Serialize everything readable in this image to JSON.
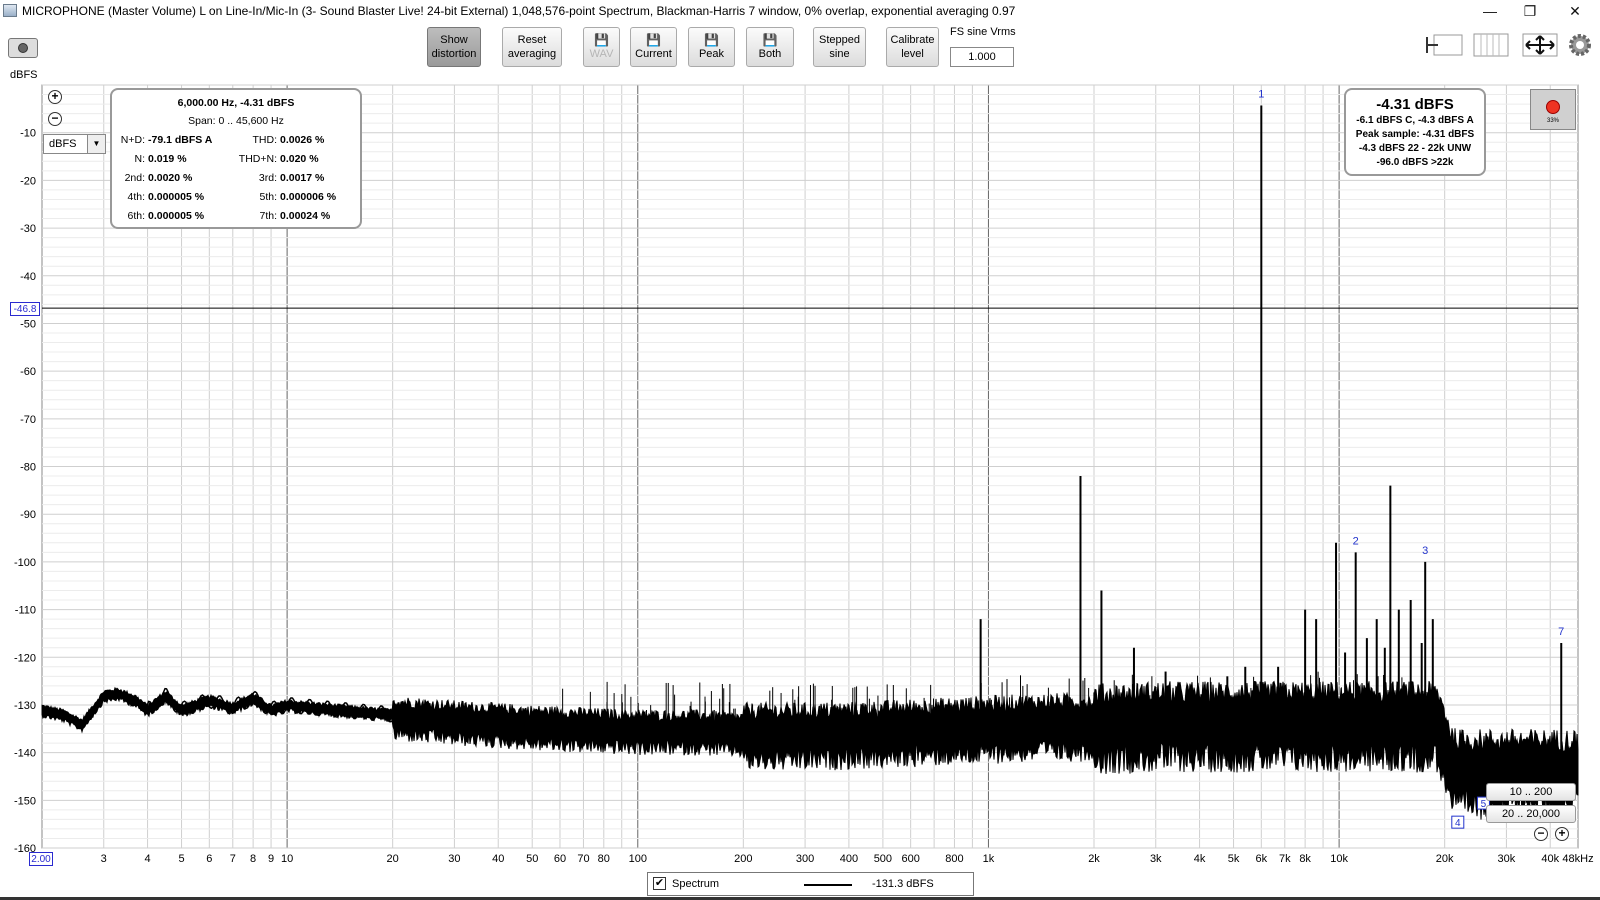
{
  "window": {
    "title": "MICROPHONE (Master Volume) L on Line-In/Mic-In (3- Sound Blaster Live! 24-bit External) 1,048,576-point Spectrum, Blackman-Harris 7 window, 0% overlap, exponential averaging 0.97",
    "minimize": "—",
    "restore": "❐",
    "close": "✕"
  },
  "toolbar": {
    "show_distortion": [
      "Show",
      "distortion"
    ],
    "reset_averaging": [
      "Reset",
      "averaging"
    ],
    "wav": "WAV",
    "current": "Current",
    "peak": "Peak",
    "both": "Both",
    "stepped_sine": [
      "Stepped",
      "sine"
    ],
    "calibrate_level": [
      "Calibrate",
      "level"
    ],
    "fs_label": "FS sine Vrms",
    "fs_value": "1.000",
    "save_icon": "💾"
  },
  "distortion_panel": {
    "header": "6,000.00 Hz, -4.31 dBFS",
    "span": "Span: 0 .. 45,600 Hz",
    "rows": [
      {
        "l1": "N+D:",
        "v1": "-79.1 dBFS A",
        "l2": "THD:",
        "v2": "0.0026 %"
      },
      {
        "l1": "N:",
        "v1": "0.019 %",
        "l2": "THD+N:",
        "v2": "0.020 %"
      },
      {
        "l1": "2nd:",
        "v1": "0.0020 %",
        "l2": "3rd:",
        "v2": "0.0017 %"
      },
      {
        "l1": "4th:",
        "v1": "0.000005 %",
        "l2": "5th:",
        "v2": "0.000006 %"
      },
      {
        "l1": "6th:",
        "v1": "0.000005 %",
        "l2": "7th:",
        "v2": "0.00024 %"
      }
    ]
  },
  "levels_panel": {
    "main": "-4.31 dBFS",
    "lines": [
      "-6.1 dBFS C, -4.3 dBFS A",
      "Peak sample: -4.31 dBFS",
      "-4.3 dBFS 22 - 22k UNW",
      "-96.0 dBFS >22k"
    ]
  },
  "record": {
    "percent": "33%"
  },
  "unit_select": {
    "value": "dBFS",
    "arrow": "▼"
  },
  "y_unit": "dBFS",
  "cursor_readout": "-46.8",
  "x_start": "2.00",
  "range_buttons": {
    "low": "10 .. 200",
    "mid": "20 .. 20,000"
  },
  "legend": {
    "check": "✔",
    "name": "Spectrum",
    "value": "-131.3 dBFS"
  },
  "chart_data": {
    "type": "line",
    "x_scale": "log",
    "xlim": [
      2,
      48000
    ],
    "ylim": [
      -160,
      0
    ],
    "ylabel": "dBFS",
    "cursor_level": -46.8,
    "y_ticks": [
      -10,
      -20,
      -30,
      -40,
      -50,
      -60,
      -70,
      -80,
      -90,
      -100,
      -110,
      -120,
      -130,
      -140,
      -150,
      -160
    ],
    "x_ticks": [
      {
        "v": 3,
        "label": "3"
      },
      {
        "v": 4,
        "label": "4"
      },
      {
        "v": 5,
        "label": "5"
      },
      {
        "v": 6,
        "label": "6"
      },
      {
        "v": 7,
        "label": "7"
      },
      {
        "v": 8,
        "label": "8"
      },
      {
        "v": 9,
        "label": "9"
      },
      {
        "v": 10,
        "label": "10"
      },
      {
        "v": 20,
        "label": "20"
      },
      {
        "v": 30,
        "label": "30"
      },
      {
        "v": 40,
        "label": "40"
      },
      {
        "v": 50,
        "label": "50"
      },
      {
        "v": 60,
        "label": "60"
      },
      {
        "v": 70,
        "label": "70"
      },
      {
        "v": 80,
        "label": "80"
      },
      {
        "v": 100,
        "label": "100"
      },
      {
        "v": 200,
        "label": "200"
      },
      {
        "v": 300,
        "label": "300"
      },
      {
        "v": 400,
        "label": "400"
      },
      {
        "v": 500,
        "label": "500"
      },
      {
        "v": 600,
        "label": "600"
      },
      {
        "v": 800,
        "label": "800"
      },
      {
        "v": 1000,
        "label": "1k"
      },
      {
        "v": 2000,
        "label": "2k"
      },
      {
        "v": 3000,
        "label": "3k"
      },
      {
        "v": 4000,
        "label": "4k"
      },
      {
        "v": 5000,
        "label": "5k"
      },
      {
        "v": 6000,
        "label": "6k"
      },
      {
        "v": 7000,
        "label": "7k"
      },
      {
        "v": 8000,
        "label": "8k"
      },
      {
        "v": 10000,
        "label": "10k"
      },
      {
        "v": 20000,
        "label": "20k"
      },
      {
        "v": 30000,
        "label": "30k"
      },
      {
        "v": 40000,
        "label": "40k"
      },
      {
        "v": 48000,
        "label": "48kHz"
      }
    ],
    "noise_floor": [
      [
        2,
        -131
      ],
      [
        2.3,
        -132
      ],
      [
        2.6,
        -134
      ],
      [
        3,
        -128
      ],
      [
        3.3,
        -127.5
      ],
      [
        3.7,
        -129
      ],
      [
        4,
        -131
      ],
      [
        4.5,
        -128
      ],
      [
        5,
        -131
      ],
      [
        6,
        -129
      ],
      [
        7,
        -130.5
      ],
      [
        8,
        -128.5
      ],
      [
        9,
        -131
      ],
      [
        10,
        -130
      ],
      [
        14,
        -131
      ],
      [
        20,
        -132
      ],
      [
        30,
        -133
      ],
      [
        50,
        -134
      ],
      [
        70,
        -134.5
      ],
      [
        100,
        -135
      ],
      [
        150,
        -135
      ],
      [
        200,
        -135.5
      ],
      [
        300,
        -135.5
      ],
      [
        500,
        -135
      ],
      [
        700,
        -134.5
      ],
      [
        1000,
        -134
      ],
      [
        1500,
        -133.5
      ],
      [
        2000,
        -133.5
      ],
      [
        3000,
        -133
      ],
      [
        5000,
        -133
      ],
      [
        8000,
        -133
      ],
      [
        12000,
        -133
      ],
      [
        19000,
        -133
      ],
      [
        20000,
        -137
      ],
      [
        21000,
        -142
      ],
      [
        21500,
        -143
      ],
      [
        48000,
        -143
      ]
    ],
    "spikes": [
      {
        "f": 6000,
        "db": -4.3,
        "label": "1"
      },
      {
        "f": 11150,
        "db": -98,
        "label": "2"
      },
      {
        "f": 17600,
        "db": -100,
        "label": "3"
      },
      {
        "f": 43000,
        "db": -117,
        "label": "7"
      },
      {
        "f": 9800,
        "db": -96,
        "label": ""
      },
      {
        "f": 14000,
        "db": -84,
        "label": ""
      },
      {
        "f": 1830,
        "db": -82,
        "label": ""
      },
      {
        "f": 2100,
        "db": -106,
        "label": ""
      },
      {
        "f": 950,
        "db": -112,
        "label": ""
      },
      {
        "f": 8000,
        "db": -110,
        "label": ""
      },
      {
        "f": 8600,
        "db": -112,
        "label": ""
      },
      {
        "f": 12000,
        "db": -116,
        "label": ""
      },
      {
        "f": 12800,
        "db": -112,
        "label": ""
      },
      {
        "f": 14800,
        "db": -110,
        "label": ""
      },
      {
        "f": 16000,
        "db": -108,
        "label": ""
      },
      {
        "f": 17200,
        "db": -117,
        "label": ""
      },
      {
        "f": 18500,
        "db": -112,
        "label": ""
      },
      {
        "f": 13500,
        "db": -118,
        "label": ""
      },
      {
        "f": 2600,
        "db": -118,
        "label": ""
      },
      {
        "f": 6700,
        "db": -122,
        "label": ""
      },
      {
        "f": 5400,
        "db": -122,
        "label": ""
      },
      {
        "f": 4800,
        "db": -124,
        "label": ""
      },
      {
        "f": 10400,
        "db": -119,
        "label": ""
      },
      {
        "f": 3200,
        "db": -123,
        "label": ""
      }
    ],
    "extra_markers": [
      {
        "f": 25800,
        "db": -151,
        "label": "5"
      },
      {
        "f": 21800,
        "db": -155,
        "label": "4"
      }
    ]
  }
}
